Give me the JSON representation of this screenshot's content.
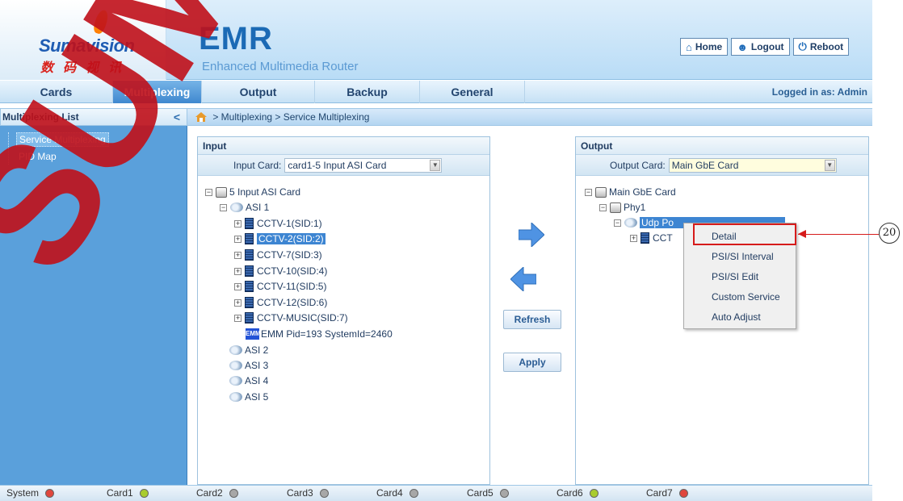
{
  "header": {
    "logo_name": "Sumavision",
    "logo_cn": "数码视讯",
    "title": "EMR",
    "subtitle": "Enhanced Multimedia Router",
    "buttons": [
      {
        "label": "Home",
        "icon": "home-icon"
      },
      {
        "label": "Logout",
        "icon": "user-icon"
      },
      {
        "label": "Reboot",
        "icon": "power-icon"
      }
    ]
  },
  "nav": {
    "tabs": [
      "Cards",
      "Multiplexing",
      "Output",
      "Backup",
      "General"
    ],
    "active_tab": "Multiplexing",
    "logged_in": "Logged in as: Admin"
  },
  "sidebar": {
    "title": "Multiplexing List",
    "items": [
      "Service Multiplexing",
      "PID Map"
    ],
    "selected": "Service Multiplexing"
  },
  "breadcrumb": "> Multiplexing > Service Multiplexing",
  "input_panel": {
    "title": "Input",
    "card_label": "Input Card:",
    "card_value": "card1-5 Input ASI Card",
    "tree": {
      "root": "5 Input ASI Card",
      "asi1": "ASI 1",
      "services": [
        "CCTV-1(SID:1)",
        "CCTV-2(SID:2)",
        "CCTV-7(SID:3)",
        "CCTV-10(SID:4)",
        "CCTV-11(SID:5)",
        "CCTV-12(SID:6)",
        "CCTV-MUSIC(SID:7)"
      ],
      "selected_service": "CCTV-2(SID:2)",
      "emm_badge": "EMM",
      "emm": "EMM Pid=193 SystemId=2460",
      "other_ports": [
        "ASI 2",
        "ASI 3",
        "ASI 4",
        "ASI 5"
      ]
    }
  },
  "actions": {
    "refresh": "Refresh",
    "apply": "Apply"
  },
  "output_panel": {
    "title": "Output",
    "card_label": "Output Card:",
    "card_value": "Main GbE Card",
    "tree": {
      "root": "Main GbE Card",
      "phy": "Phy1",
      "udp": "Udp Po",
      "service": "CCT"
    }
  },
  "context_menu": {
    "items": [
      "Detail",
      "PSI/SI Interval",
      "PSI/SI Edit",
      "Custom Service",
      "Auto Adjust"
    ],
    "highlighted": "Detail"
  },
  "callout": "20",
  "status_bar": [
    {
      "label": "System",
      "status": "red"
    },
    {
      "label": "Card1",
      "status": "green"
    },
    {
      "label": "Card2",
      "status": "gray"
    },
    {
      "label": "Card3",
      "status": "gray"
    },
    {
      "label": "Card4",
      "status": "gray"
    },
    {
      "label": "Card5",
      "status": "gray"
    },
    {
      "label": "Card6",
      "status": "green"
    },
    {
      "label": "Card7",
      "status": "red"
    }
  ],
  "colors": {
    "accent": "#3f88cf",
    "sidebar": "#5aa0db",
    "selection": "#3d85d2",
    "callout_red": "#d61b1b",
    "led_red": "#e0473d",
    "led_green": "#a9cc2e",
    "led_gray": "#a7a7a7"
  },
  "watermark": "SUMAVISION"
}
